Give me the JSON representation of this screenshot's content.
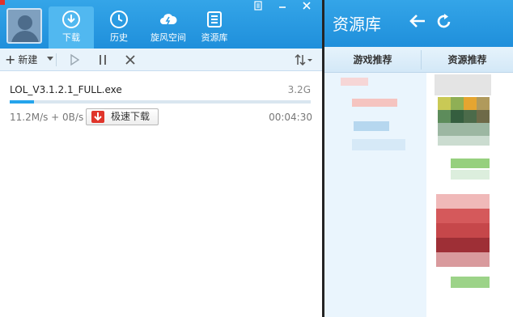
{
  "left_panel": {
    "nav": {
      "tabs": [
        {
          "label": "下载",
          "icon": "download-icon",
          "active": true
        },
        {
          "label": "历史",
          "icon": "history-clock-icon",
          "active": false
        },
        {
          "label": "旋风空间",
          "icon": "cloud-space-icon",
          "active": false
        },
        {
          "label": "资源库",
          "icon": "resource-library-icon",
          "active": false
        }
      ],
      "window_buttons": [
        "restore-icon",
        "minimize-icon",
        "close-icon"
      ]
    },
    "toolbar": {
      "new_label": "新建",
      "icons": [
        "play-icon",
        "pause-icon",
        "delete-x-icon",
        "sort-icon"
      ]
    },
    "task": {
      "name": "LOL_V3.1.2.1_FULL.exe",
      "size": "3.2G",
      "speed": "11.2M/s + 0B/s",
      "accelerate_label": "极速下载",
      "time_remaining": "00:04:30",
      "progress": 0.08
    }
  },
  "right_panel": {
    "title": "资源库",
    "tabs": [
      "游戏推荐",
      "资源推荐"
    ]
  },
  "colors": {
    "header_blue": "#2a9be4",
    "active_tab": "#51b8f0",
    "progress_fill": "#25a4ec",
    "accelerate_red": "#e0352b"
  }
}
